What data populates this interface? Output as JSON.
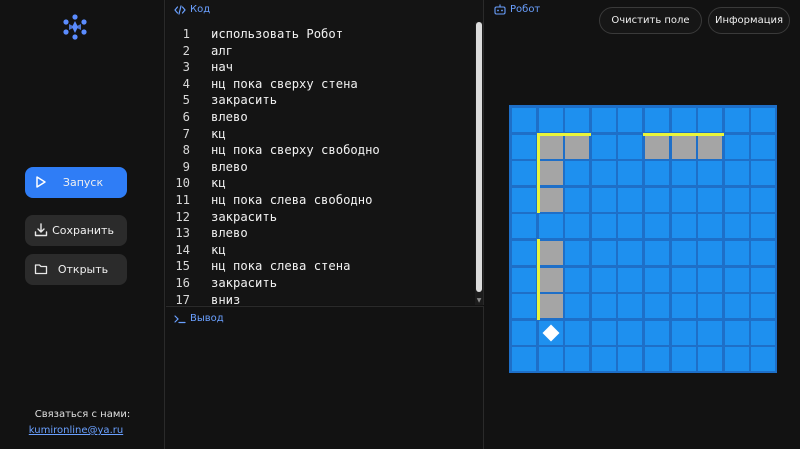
{
  "sidebar": {
    "run_label": "Запуск",
    "save_label": "Сохранить",
    "open_label": "Открыть",
    "contact_label": "Связаться с нами:",
    "contact_email": "kumironline@ya.ru"
  },
  "code_panel": {
    "title": "Код",
    "lines": [
      {
        "n": "1",
        "t": "использовать Робот"
      },
      {
        "n": "2",
        "t": "алг"
      },
      {
        "n": "3",
        "t": "нач"
      },
      {
        "n": "4",
        "t": "нц пока сверху стена"
      },
      {
        "n": "5",
        "t": "закрасить"
      },
      {
        "n": "6",
        "t": "влево"
      },
      {
        "n": "7",
        "t": "кц"
      },
      {
        "n": "8",
        "t": "нц пока сверху свободно"
      },
      {
        "n": "9",
        "t": "влево"
      },
      {
        "n": "10",
        "t": "кц"
      },
      {
        "n": "11",
        "t": "нц пока слева свободно"
      },
      {
        "n": "12",
        "t": "закрасить"
      },
      {
        "n": "13",
        "t": "влево"
      },
      {
        "n": "14",
        "t": "кц"
      },
      {
        "n": "15",
        "t": "нц пока слева стена"
      },
      {
        "n": "16",
        "t": "закрасить"
      },
      {
        "n": "17",
        "t": "вниз"
      }
    ]
  },
  "output_panel": {
    "title": "Вывод"
  },
  "robot_panel": {
    "title": "Робот",
    "clear_label": "Очистить поле",
    "info_label": "Информация",
    "grid": {
      "cols": 10,
      "rows": 10,
      "painted": [
        [
          1,
          1
        ],
        [
          2,
          1
        ],
        [
          5,
          1
        ],
        [
          6,
          1
        ],
        [
          7,
          1
        ],
        [
          1,
          2
        ],
        [
          1,
          3
        ],
        [
          1,
          5
        ],
        [
          1,
          6
        ],
        [
          1,
          7
        ]
      ],
      "walls_top": [
        [
          1,
          1
        ],
        [
          2,
          1
        ],
        [
          5,
          1
        ],
        [
          6,
          1
        ],
        [
          7,
          1
        ]
      ],
      "walls_left": [
        [
          1,
          1
        ],
        [
          1,
          2
        ],
        [
          1,
          3
        ],
        [
          1,
          5
        ],
        [
          1,
          6
        ],
        [
          1,
          7
        ]
      ],
      "robot": [
        1,
        8
      ]
    }
  },
  "colors": {
    "accent": "#2f7df6",
    "field": "#1e90ef",
    "painted": "#a5a5a5",
    "wall": "#e9f53a",
    "link": "#6aa0ff"
  }
}
